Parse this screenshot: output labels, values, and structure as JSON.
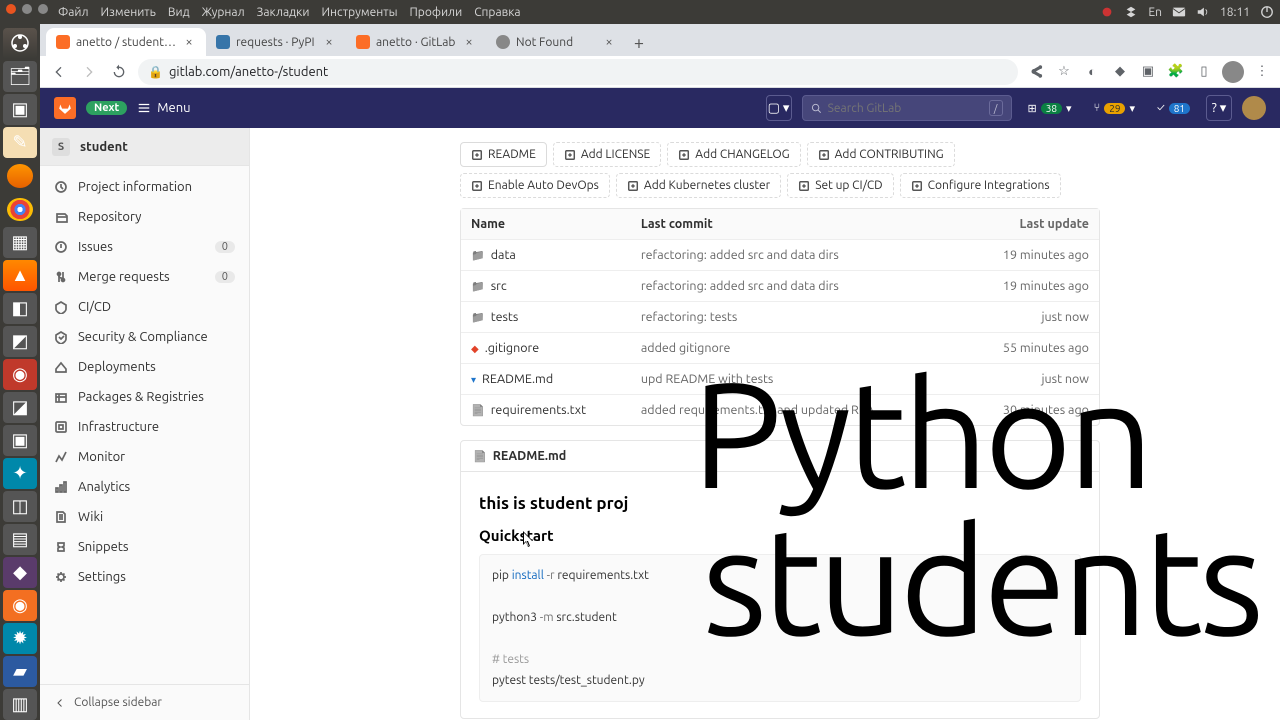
{
  "desktop": {
    "menus": [
      "Файл",
      "Изменить",
      "Вид",
      "Журнал",
      "Закладки",
      "Инструменты",
      "Профили",
      "Справка"
    ],
    "clock": "18:11",
    "lang": "En"
  },
  "browser": {
    "tabs": [
      {
        "title": "anetto / student · GitLab",
        "active": true
      },
      {
        "title": "requests · PyPI",
        "active": false
      },
      {
        "title": "anetto · GitLab",
        "active": false
      },
      {
        "title": "Not Found",
        "active": false
      }
    ],
    "url": "gitlab.com/anetto-/student"
  },
  "gitlab": {
    "next_label": "Next",
    "menu_label": "Menu",
    "search_placeholder": "Search GitLab",
    "badges": {
      "issues": "38",
      "mrs": "29",
      "todos": "81"
    },
    "project": "student",
    "sidebar": {
      "items": [
        {
          "label": "Project information"
        },
        {
          "label": "Repository"
        },
        {
          "label": "Issues",
          "count": "0"
        },
        {
          "label": "Merge requests",
          "count": "0"
        },
        {
          "label": "CI/CD"
        },
        {
          "label": "Security & Compliance"
        },
        {
          "label": "Deployments"
        },
        {
          "label": "Packages & Registries"
        },
        {
          "label": "Infrastructure"
        },
        {
          "label": "Monitor"
        },
        {
          "label": "Analytics"
        },
        {
          "label": "Wiki"
        },
        {
          "label": "Snippets"
        },
        {
          "label": "Settings"
        }
      ],
      "collapse": "Collapse sidebar"
    },
    "actions": [
      {
        "label": "README",
        "kind": "solid"
      },
      {
        "label": "Add LICENSE",
        "kind": "dashed"
      },
      {
        "label": "Add CHANGELOG",
        "kind": "dashed"
      },
      {
        "label": "Add CONTRIBUTING",
        "kind": "dashed"
      },
      {
        "label": "Enable Auto DevOps",
        "kind": "dashed"
      },
      {
        "label": "Add Kubernetes cluster",
        "kind": "dashed"
      },
      {
        "label": "Set up CI/CD",
        "kind": "dashed"
      },
      {
        "label": "Configure Integrations",
        "kind": "dashed"
      }
    ],
    "table": {
      "headers": {
        "name": "Name",
        "commit": "Last commit",
        "update": "Last update"
      },
      "rows": [
        {
          "icon": "folder",
          "name": "data",
          "commit": "refactoring: added src and data dirs",
          "update": "19 minutes ago"
        },
        {
          "icon": "folder",
          "name": "src",
          "commit": "refactoring: added src and data dirs",
          "update": "19 minutes ago"
        },
        {
          "icon": "folder",
          "name": "tests",
          "commit": "refactoring: tests",
          "update": "just now"
        },
        {
          "icon": "git",
          "name": ".gitignore",
          "commit": "added gitignore",
          "update": "55 minutes ago"
        },
        {
          "icon": "md",
          "name": "README.md",
          "commit": "upd README with tests",
          "update": "just now"
        },
        {
          "icon": "file",
          "name": "requirements.txt",
          "commit": "added requirements.txt and updated REA…",
          "update": "30 minutes ago"
        }
      ]
    },
    "readme": {
      "filename": "README.md",
      "h1": "this is student proj",
      "h2": "Quickstart",
      "code": {
        "l1a": "pip ",
        "l1b": "install",
        "l1c": " -r",
        "l1d": " requirements.txt",
        "l2a": "python3 ",
        "l2b": "-m",
        "l2c": " src.student",
        "l3": "# tests",
        "l4": "pytest tests/test_student.py"
      }
    }
  },
  "overlay": {
    "l1": "Python",
    "l2": "students"
  }
}
